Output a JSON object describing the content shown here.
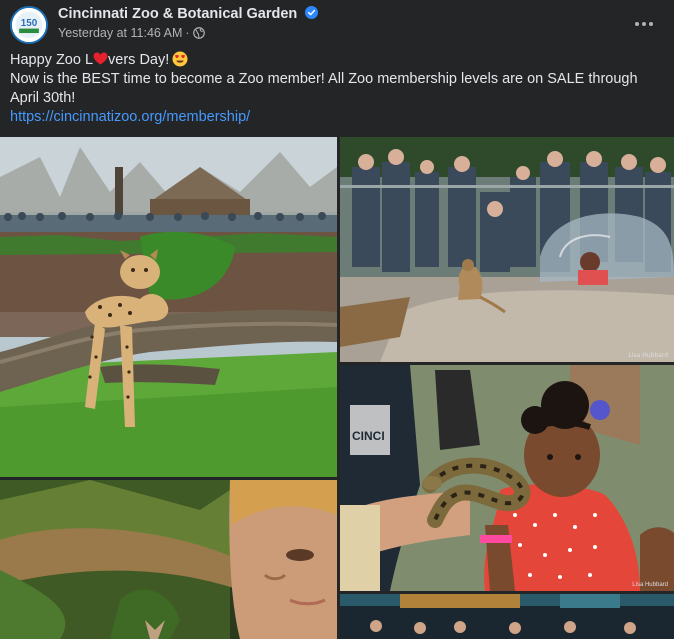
{
  "post": {
    "page_name": "Cincinnati Zoo & Botanical Garden",
    "timestamp": "Yesterday at 11:46 AM",
    "separator": "·",
    "audience_icon": "globe-icon",
    "verified_icon": "verified-badge-icon",
    "more_icon": "more-options-icon",
    "text_line1_before": "Happy Zoo L",
    "text_line1_after": "vers Day!",
    "text_line2": "Now is the BEST time to become a Zoo member! All Zoo membership levels are on SALE through April 30th!",
    "link": "https://cincinnatizoo.org/membership/"
  },
  "photos": [
    {
      "id": "cheetah",
      "alt_icon": "cheetah-photo"
    },
    {
      "id": "meerkat",
      "alt_icon": "meerkat-photo",
      "credit": "Lisa Hubbard"
    },
    {
      "id": "snake",
      "alt_icon": "snake-photo",
      "credit": "Lisa Hubbard"
    },
    {
      "id": "boy",
      "alt_icon": "boy-photo"
    },
    {
      "id": "crowd",
      "alt_icon": "crowd-photo"
    }
  ],
  "colors": {
    "background": "#242526",
    "text": "#e4e6eb",
    "secondary": "#b0b3b8",
    "link": "#4599ff",
    "verified": "#2d88ff"
  }
}
